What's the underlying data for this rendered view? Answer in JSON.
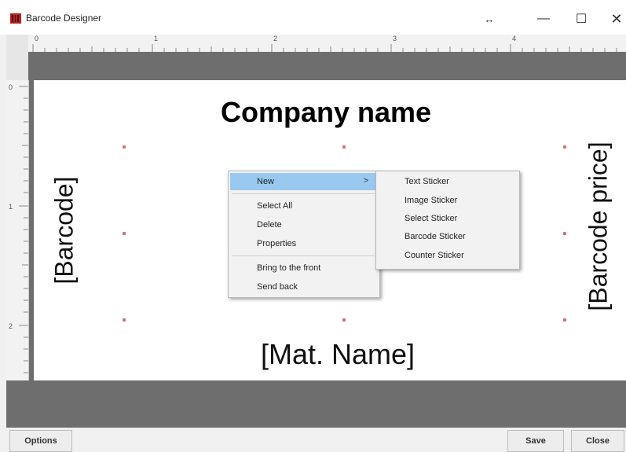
{
  "window": {
    "title": "Barcode Designer"
  },
  "title_controls": {
    "resize": "↔",
    "minimize": "—",
    "maximize": "☐",
    "close": "✕"
  },
  "rulers": {
    "top_labels": [
      "0",
      "1",
      "2",
      "3",
      "4"
    ],
    "left_labels": [
      "0",
      "1",
      "2"
    ]
  },
  "label": {
    "company": "Company name",
    "barcode": "[Barcode]",
    "barcode_price": "[Barcode price]",
    "mat_name": "[Mat. Name]"
  },
  "context_menu": {
    "new": "New",
    "new_arrow": ">",
    "select_all": "Select All",
    "delete": "Delete",
    "properties": "Properties",
    "bring_front": "Bring to the front",
    "send_back": "Send back"
  },
  "submenu": {
    "text": "Text Sticker",
    "image": "Image Sticker",
    "select": "Select Sticker",
    "barcode": "Barcode Sticker",
    "counter": "Counter Sticker"
  },
  "buttons": {
    "options": "Options",
    "save": "Save",
    "close": "Close"
  },
  "colors": {
    "highlight": "#99c9ef",
    "canvas_gray": "#6e6e6e",
    "handle": "#d77070",
    "app_icon": "#b22222"
  }
}
